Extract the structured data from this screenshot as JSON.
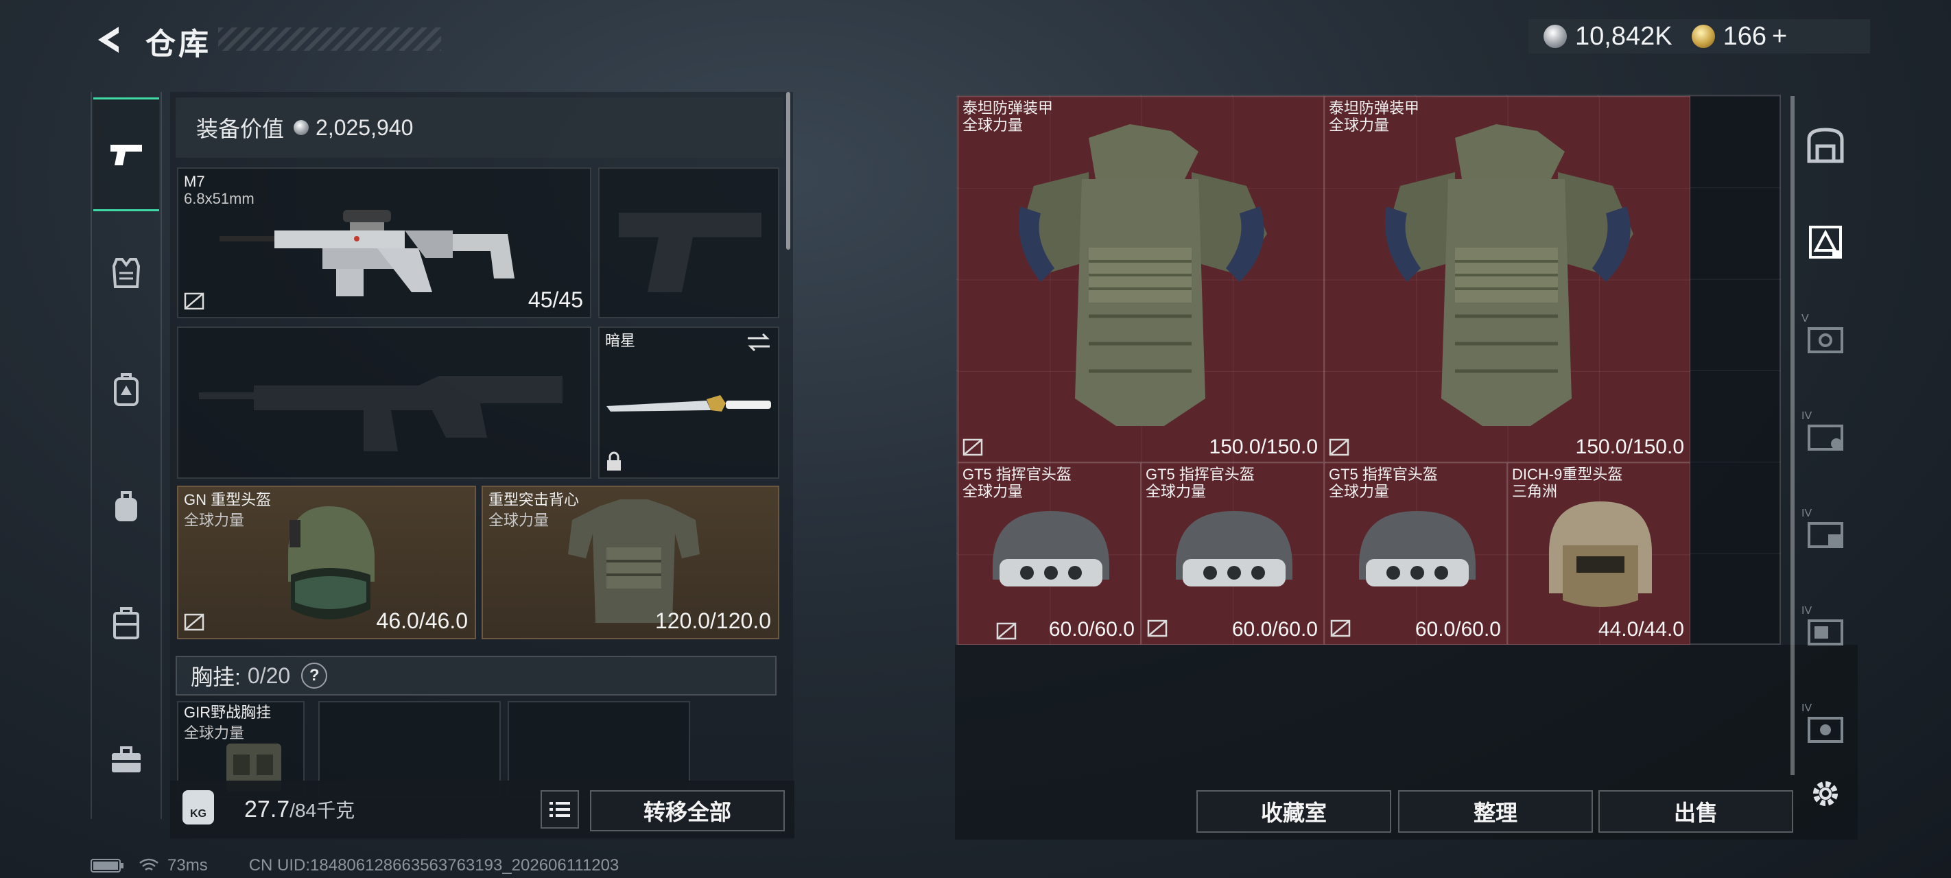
{
  "header": {
    "title": "仓库"
  },
  "currency": {
    "silver": "10,842K",
    "gold": "166",
    "plus": "+"
  },
  "equipment": {
    "value_label": "装备价值",
    "value": "2,025,940",
    "primary": {
      "name": "M7",
      "caliber": "6.8x51mm",
      "ammo": "45/45"
    },
    "melee": {
      "name": "暗星"
    },
    "helmet": {
      "name": "GN 重型头盔",
      "faction": "全球力量",
      "durability": "46.0/46.0"
    },
    "armor": {
      "name": "重型突击背心",
      "faction": "全球力量",
      "durability": "120.0/120.0"
    },
    "chest_rig": {
      "label": "胸挂:",
      "count": "0/20",
      "help": "?"
    },
    "rig_item": {
      "name": "GIR野战胸挂",
      "faction": "全球力量"
    }
  },
  "weight": {
    "badge": "KG",
    "current": "27.7",
    "max": "/84千克"
  },
  "buttons": {
    "transfer_all": "转移全部",
    "collection": "收藏室",
    "organize": "整理",
    "sell": "出售"
  },
  "storage_items": [
    {
      "name": "泰坦防弹装甲",
      "faction": "全球力量",
      "durability": "150.0/150.0"
    },
    {
      "name": "泰坦防弹装甲",
      "faction": "全球力量",
      "durability": "150.0/150.0"
    },
    {
      "name": "GT5 指挥官头盔",
      "faction": "全球力量",
      "durability": "60.0/60.0"
    },
    {
      "name": "GT5 指挥官头盔",
      "faction": "全球力量",
      "durability": "60.0/60.0"
    },
    {
      "name": "GT5 指挥官头盔",
      "faction": "全球力量",
      "durability": "60.0/60.0"
    },
    {
      "name": "DICH-9重型头盔",
      "faction": "三角洲",
      "durability": "44.0/44.0"
    }
  ],
  "right_rail": {
    "tiers": [
      "V",
      "IV",
      "IV",
      "IV",
      "IV"
    ]
  },
  "status": {
    "ping": "73ms",
    "uid": "CN UID:18480612866356376319​3_202606111203"
  },
  "colors": {
    "accent": "#3fd9a6",
    "rare_red": "#5a262c",
    "brown_slot": "#4a3d2c"
  }
}
